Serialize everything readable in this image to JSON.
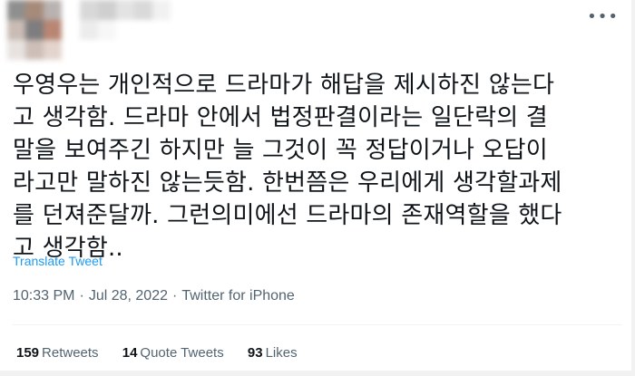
{
  "tweet": {
    "text": "우영우는 개인적으로 드라마가 해답을 제시하진 않는다\n고 생각함. 드라마 안에서 법정판결이라는 일단락의 결\n말을 보여주긴 하지만 늘 그것이 꼭 정답이거나 오답이\n라고만 말하진 않는듯함. 한번쯤은 우리에게 생각할과제\n를 던져준달까. 그런의미에선 드라마의 존재역할을 했다\n고 생각함..",
    "translate_label": "Translate Tweet",
    "time": "10:33 PM",
    "date": "Jul 28, 2022",
    "source": "Twitter for iPhone",
    "separator": "·",
    "more_icon": "more-horizontal-icon"
  },
  "stats": {
    "retweets_count": "159",
    "retweets_label": "Retweets",
    "quotes_count": "14",
    "quotes_label": "Quote Tweets",
    "likes_count": "93",
    "likes_label": "Likes"
  },
  "colors": {
    "link": "#1d9bf0",
    "muted": "#536471",
    "text": "#0f1419"
  }
}
